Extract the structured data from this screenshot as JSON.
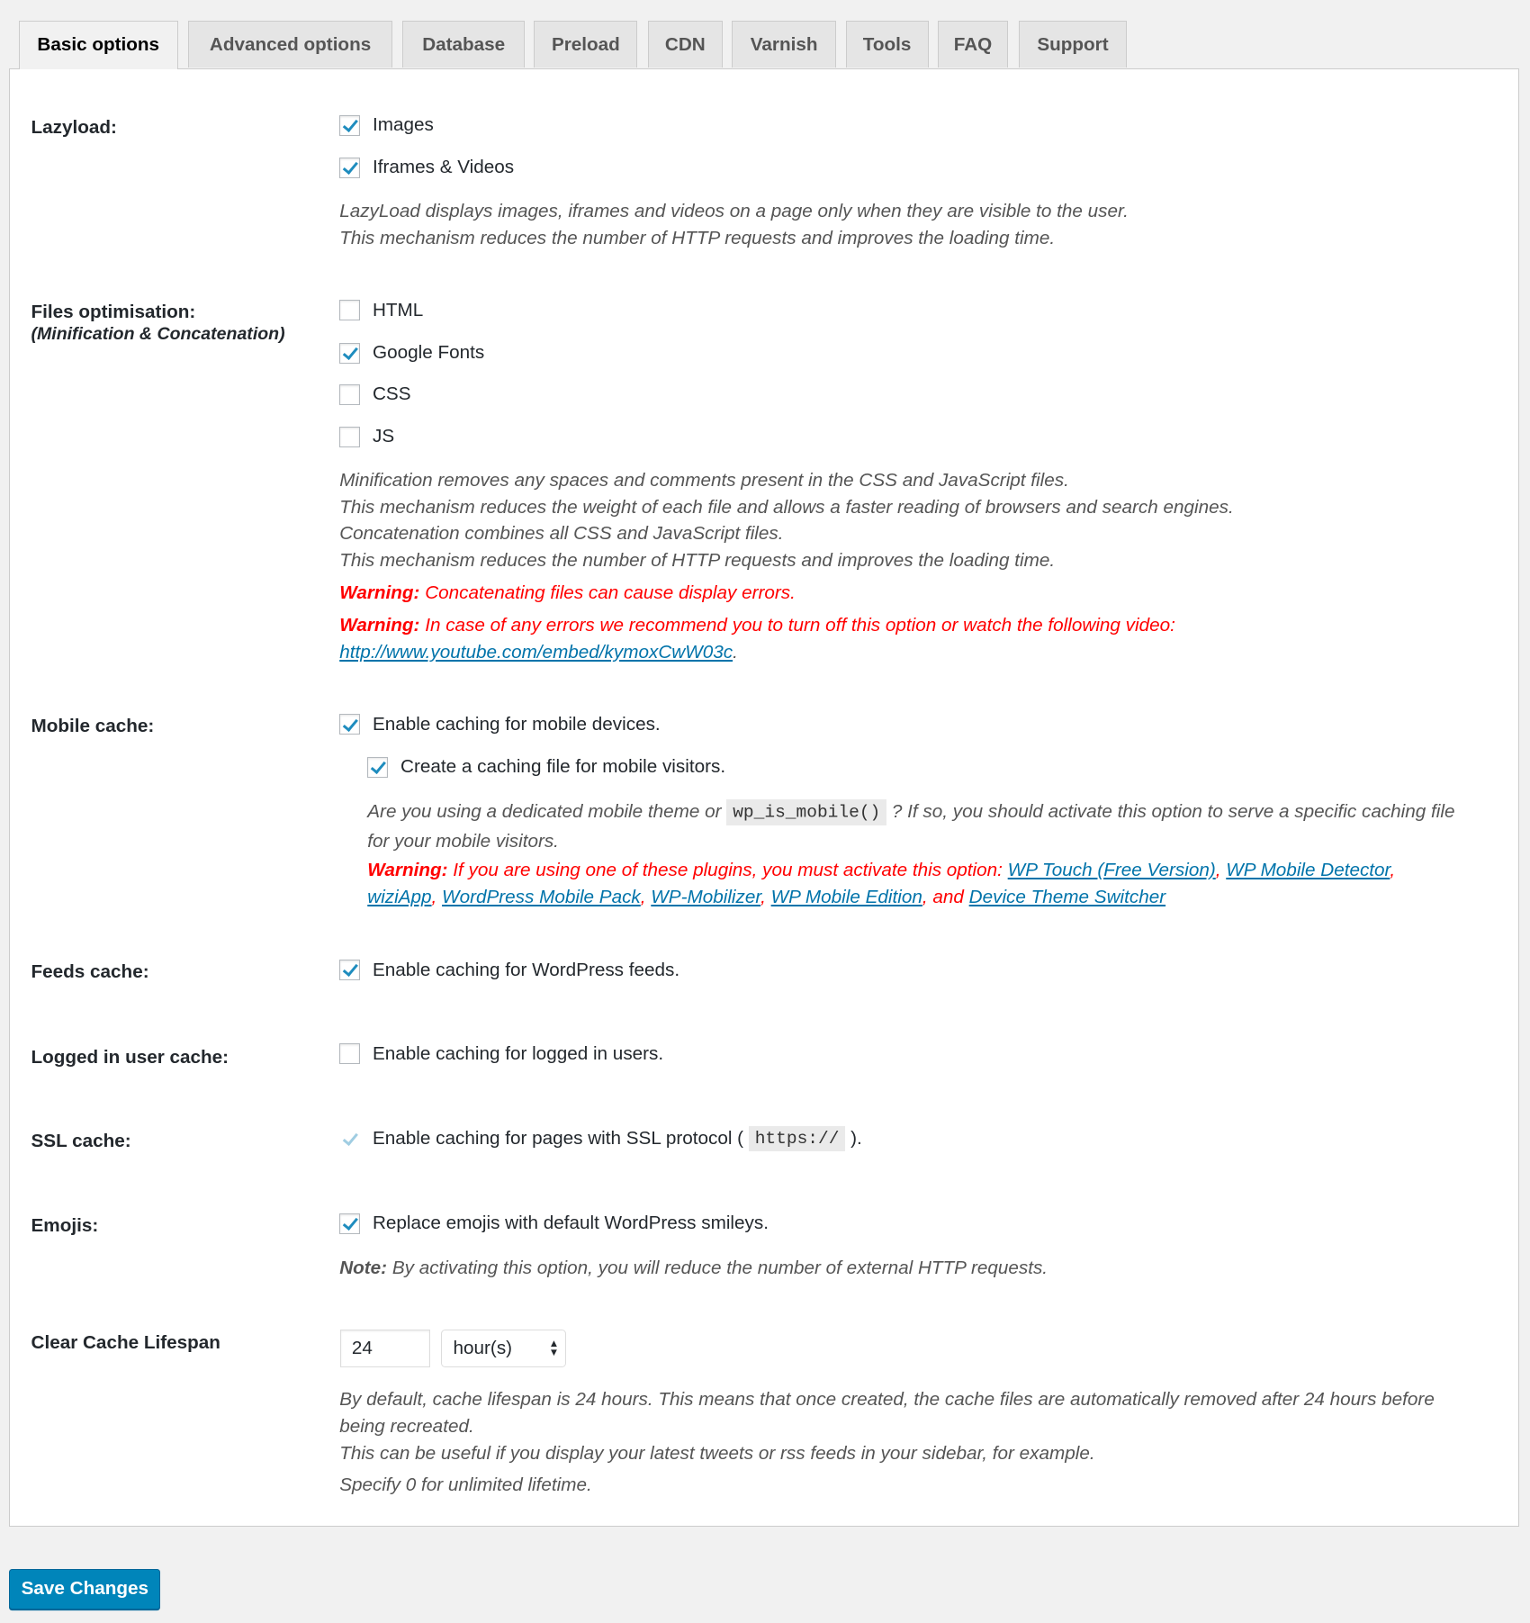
{
  "tabs": [
    {
      "label": "Basic options",
      "active": true
    },
    {
      "label": "Advanced options"
    },
    {
      "label": "Database"
    },
    {
      "label": "Preload"
    },
    {
      "label": "CDN"
    },
    {
      "label": "Varnish"
    },
    {
      "label": "Tools"
    },
    {
      "label": "FAQ"
    },
    {
      "label": "Support"
    }
  ],
  "lazyload": {
    "label": "Lazyload:",
    "options": [
      {
        "label": "Images",
        "checked": true
      },
      {
        "label": "Iframes & Videos",
        "checked": true
      }
    ],
    "desc": [
      "LazyLoad displays images, iframes and videos on a page only when they are visible to the user.",
      "This mechanism reduces the number of HTTP requests and improves the loading time."
    ]
  },
  "files": {
    "label": "Files optimisation:",
    "sublabel": "(Minification & Concatenation)",
    "options": [
      {
        "label": "HTML",
        "checked": false
      },
      {
        "label": "Google Fonts",
        "checked": true
      },
      {
        "label": "CSS",
        "checked": false
      },
      {
        "label": "JS",
        "checked": false
      }
    ],
    "desc": [
      "Minification removes any spaces and comments present in the CSS and JavaScript files.",
      "This mechanism reduces the weight of each file and allows a faster reading of browsers and search engines.",
      "Concatenation combines all CSS and JavaScript files.",
      "This mechanism reduces the number of HTTP requests and improves the loading time."
    ],
    "warning_label": "Warning:",
    "warning1": "Concatenating files can cause display errors.",
    "warning2": "In case of any errors we recommend you to turn off this option or watch the following video:",
    "video_link": "http://www.youtube.com/embed/kymoxCwW03c",
    "period": "."
  },
  "mobile": {
    "label": "Mobile cache:",
    "option1": {
      "label": "Enable caching for mobile devices.",
      "checked": true
    },
    "option2": {
      "label": "Create a caching file for mobile visitors.",
      "checked": true
    },
    "desc_a": "Are you using a dedicated mobile theme or",
    "code": "wp_is_mobile()",
    "desc_b": "? If so, you should activate this option to serve a specific caching file for your mobile visitors.",
    "warning_label": "Warning:",
    "warning": "If you are using one of these plugins, you must activate this option:",
    "plugins": [
      "WP Touch (Free Version)",
      "WP Mobile Detector",
      "wiziApp",
      "WordPress Mobile Pack",
      "WP-Mobilizer",
      "WP Mobile Edition"
    ],
    "and": "and",
    "last_plugin": "Device Theme Switcher"
  },
  "feeds": {
    "label": "Feeds cache:",
    "option": "Enable caching for WordPress feeds.",
    "checked": true
  },
  "logged": {
    "label": "Logged in user cache:",
    "option": "Enable caching for logged in users.",
    "checked": false
  },
  "ssl": {
    "label": "SSL cache:",
    "option_a": "Enable caching for pages with SSL protocol (",
    "code": "https://",
    "option_b": ").",
    "checked": true,
    "disabled": true
  },
  "emojis": {
    "label": "Emojis:",
    "option": "Replace emojis with default WordPress smileys.",
    "checked": true,
    "note_label": "Note:",
    "note": "By activating this option, you will reduce the number of external HTTP requests."
  },
  "lifespan": {
    "label": "Clear Cache Lifespan",
    "value": "24",
    "unit": "hour(s)",
    "desc": [
      "By default, cache lifespan is 24 hours. This means that once created, the cache files are automatically removed after 24 hours before being recreated.",
      "This can be useful if you display your latest tweets or rss feeds in your sidebar, for example.",
      "Specify 0 for unlimited lifetime."
    ]
  },
  "save_label": "Save Changes"
}
